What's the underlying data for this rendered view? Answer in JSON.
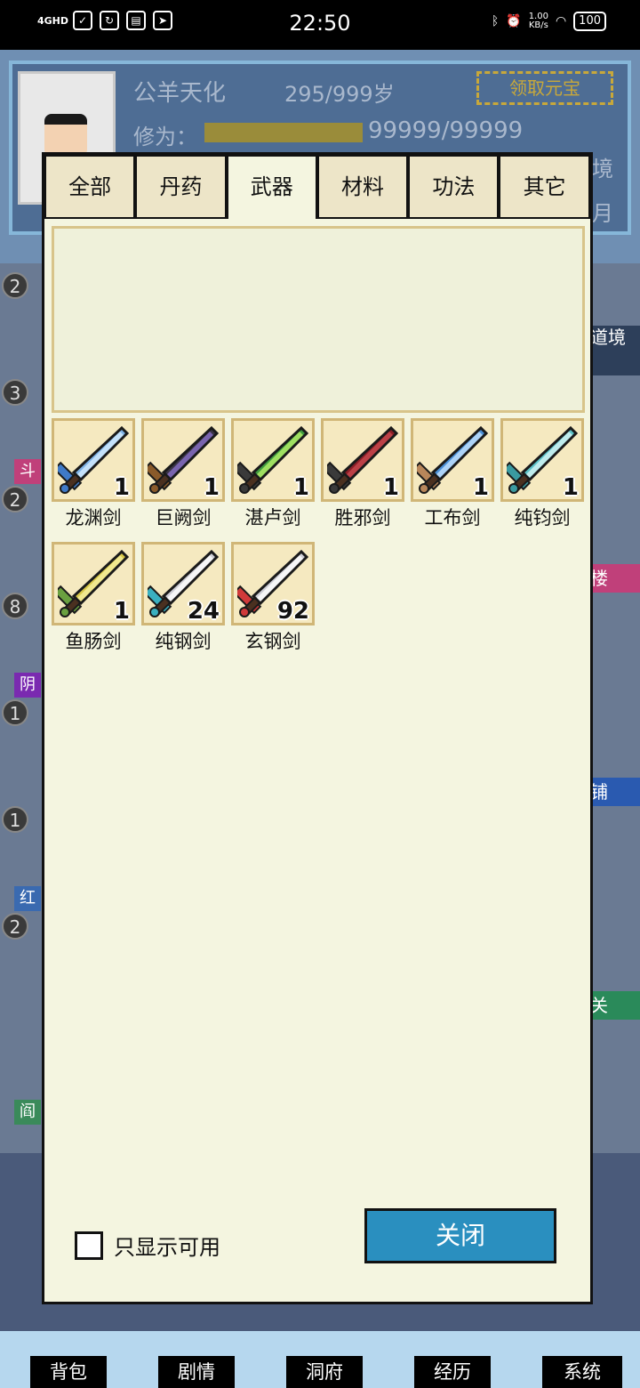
{
  "status_bar": {
    "network": "4GHD",
    "time": "22:50",
    "speed_value": "1.00",
    "speed_unit": "KB/s",
    "battery": "100"
  },
  "background": {
    "player_name": "公羊天化",
    "age": "295/999岁",
    "claim_button": "领取元宝",
    "cultivation_label": "修为：",
    "cultivation_value": "99999/99999",
    "right_edge_1": "境",
    "right_edge_2": "月",
    "right_tags": [
      "道境",
      "楼",
      "铺",
      "关"
    ],
    "left_tags": [
      "斗",
      "阴",
      "红",
      "阎"
    ],
    "badges": [
      "2",
      "3",
      "2",
      "8",
      "1",
      "1",
      "2"
    ]
  },
  "modal": {
    "tabs": [
      {
        "label": "全部",
        "active": false
      },
      {
        "label": "丹药",
        "active": false
      },
      {
        "label": "武器",
        "active": true
      },
      {
        "label": "材料",
        "active": false
      },
      {
        "label": "功法",
        "active": false
      },
      {
        "label": "其它",
        "active": false
      }
    ],
    "items": [
      {
        "name": "龙渊剑",
        "count": "1",
        "blade": "#7fb3e6",
        "edge": "#d6ecff",
        "guard": "#3f7ac8"
      },
      {
        "name": "巨阙剑",
        "count": "1",
        "blade": "#3a3446",
        "edge": "#8a70c8",
        "guard": "#8a5a2a"
      },
      {
        "name": "湛卢剑",
        "count": "1",
        "blade": "#3f9a3f",
        "edge": "#b8f06a",
        "guard": "#3a3a3a"
      },
      {
        "name": "胜邪剑",
        "count": "1",
        "blade": "#8a1e26",
        "edge": "#c84a50",
        "guard": "#3a3a3a"
      },
      {
        "name": "工布剑",
        "count": "1",
        "blade": "#4a8fd6",
        "edge": "#c6e4ff",
        "guard": "#b8865a"
      },
      {
        "name": "纯钧剑",
        "count": "1",
        "blade": "#5cc2c8",
        "edge": "#d8f6f6",
        "guard": "#3a9aa0"
      },
      {
        "name": "鱼肠剑",
        "count": "1",
        "blade": "#d8c84a",
        "edge": "#f6f0a0",
        "guard": "#6aa040"
      },
      {
        "name": "纯钢剑",
        "count": "24",
        "blade": "#cfcfd6",
        "edge": "#ffffff",
        "guard": "#3ab0c0"
      },
      {
        "name": "玄钢剑",
        "count": "92",
        "blade": "#cfcfd6",
        "edge": "#ffffff",
        "guard": "#d03a3a"
      }
    ],
    "checkbox_label": "只显示可用",
    "close_label": "关闭"
  },
  "bottom_nav": [
    "背包",
    "剧情",
    "洞府",
    "经历",
    "系统"
  ]
}
